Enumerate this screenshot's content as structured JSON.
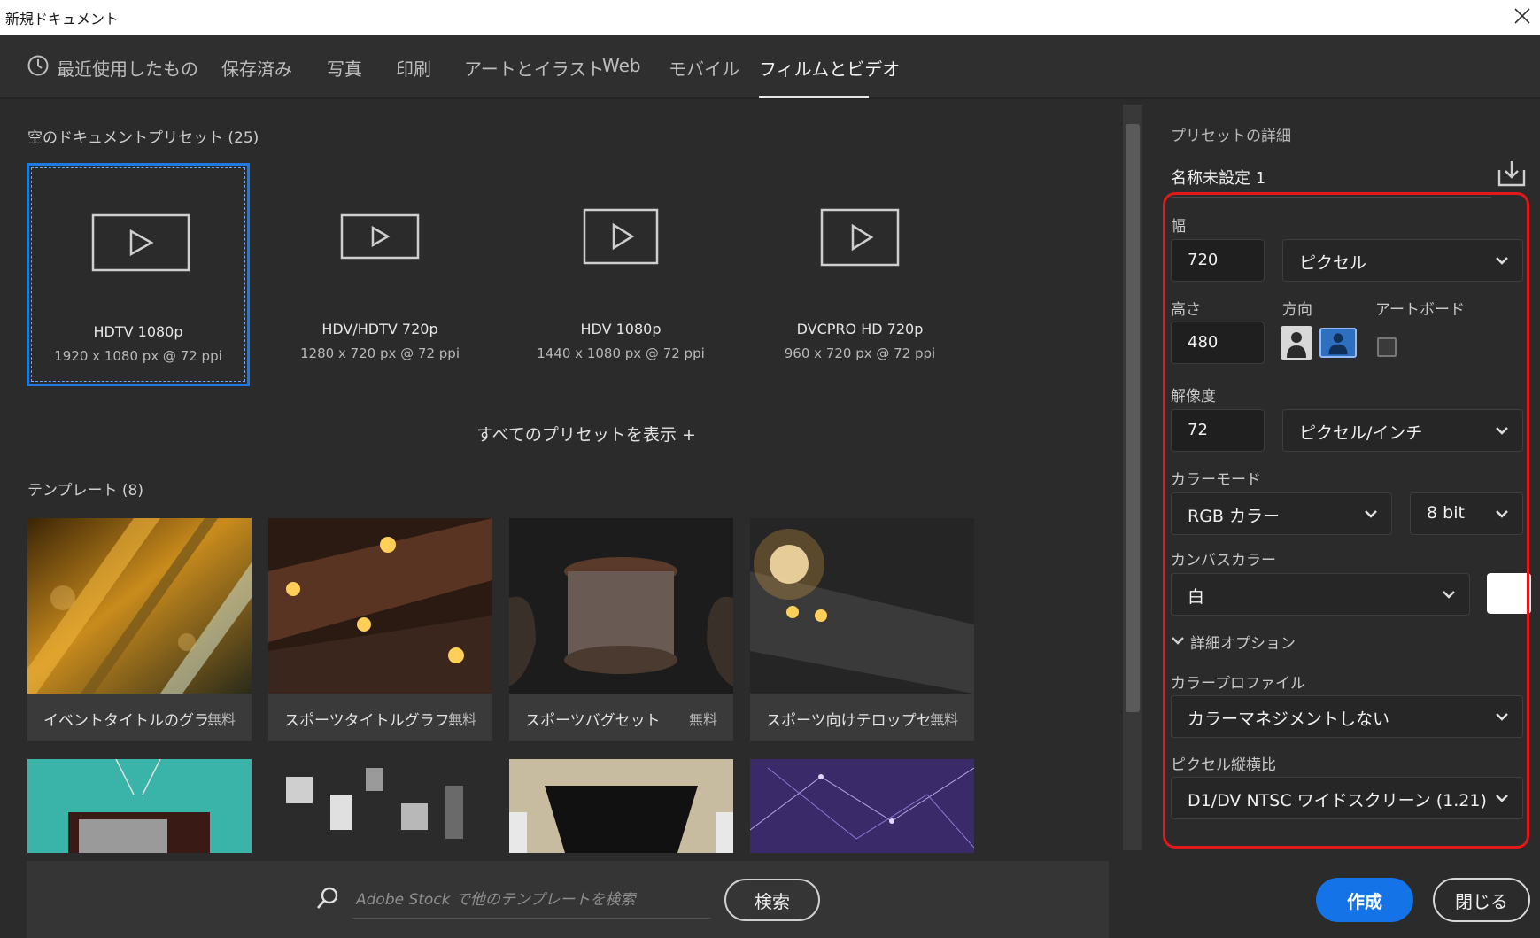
{
  "window": {
    "title": "新規ドキュメント"
  },
  "tabs": [
    {
      "label": "最近使用したもの",
      "icon": "clock-icon"
    },
    {
      "label": "保存済み"
    },
    {
      "label": "写真"
    },
    {
      "label": "印刷"
    },
    {
      "label": "アートとイラスト"
    },
    {
      "label": "Web"
    },
    {
      "label": "モバイル"
    },
    {
      "label": "フィルムとビデオ",
      "active": true
    }
  ],
  "presets": {
    "heading": "空のドキュメントプリセット",
    "count": "(25)",
    "items": [
      {
        "name": "HDTV 1080p",
        "desc": "1920 x 1080 px @ 72 ppi",
        "selected": true
      },
      {
        "name": "HDV/HDTV 720p",
        "desc": "1280 x 720 px @ 72 ppi"
      },
      {
        "name": "HDV 1080p",
        "desc": "1440 x 1080 px @ 72 ppi"
      },
      {
        "name": "DVCPRO HD 720p",
        "desc": "960 x 720 px @ 72 ppi"
      }
    ],
    "show_all": "すべてのプリセットを表示 +"
  },
  "templates": {
    "heading": "テンプレート",
    "count": "(8)",
    "items": [
      {
        "name": "イベントタイトルのグラ...",
        "price": "無料"
      },
      {
        "name": "スポーツタイトルグラフ...",
        "price": "無料"
      },
      {
        "name": "スポーツバグセット",
        "price": "無料"
      },
      {
        "name": "スポーツ向けテロップセ...",
        "price": "無料"
      }
    ]
  },
  "search": {
    "placeholder": "Adobe Stock で他のテンプレートを検索",
    "button": "検索"
  },
  "details": {
    "heading": "プリセットの詳細",
    "doc_name": "名称未設定 1",
    "width_label": "幅",
    "width_value": "720",
    "width_unit": "ピクセル",
    "height_label": "高さ",
    "height_value": "480",
    "orientation_label": "方向",
    "artboard_label": "アートボード",
    "resolution_label": "解像度",
    "resolution_value": "72",
    "resolution_unit": "ピクセル/インチ",
    "color_mode_label": "カラーモード",
    "color_mode_value": "RGB カラー",
    "bit_depth": "8 bit",
    "canvas_color_label": "カンバスカラー",
    "canvas_color_value": "白",
    "advanced_options": "詳細オプション",
    "color_profile_label": "カラープロファイル",
    "color_profile_value": "カラーマネジメントしない",
    "pixel_aspect_label": "ピクセル縦横比",
    "pixel_aspect_value": "D1/DV NTSC ワイドスクリーン (1.21)"
  },
  "actions": {
    "create": "作成",
    "close": "閉じる"
  },
  "colors": {
    "accent": "#1473e6",
    "highlight": "#e01a1a",
    "selected_border": "#1f7ae0"
  }
}
